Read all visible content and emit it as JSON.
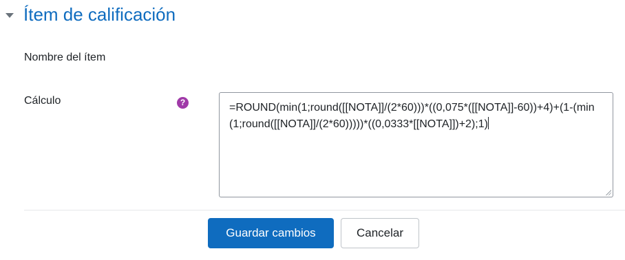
{
  "section": {
    "title": "Ítem de calificación",
    "icon": "chevron-down-icon"
  },
  "form": {
    "item_name_label": "Nombre del ítem",
    "calculation_label": "Cálculo",
    "help_icon": "question-circle-icon",
    "help_glyph": "?",
    "calculation_value": "=ROUND(min(1;round([[NOTA]]/(2*60)))*((0,075*([[NOTA]]-60))+4)+(1-(min(1;round([[NOTA]]/(2*60)))))*((0,0333*[[NOTA]])+2);1)"
  },
  "buttons": {
    "save_label": "Guardar cambios",
    "cancel_label": "Cancelar"
  },
  "colors": {
    "accent": "#0f6cbf",
    "help_icon": "#a03aa8",
    "text": "#1d2125"
  }
}
